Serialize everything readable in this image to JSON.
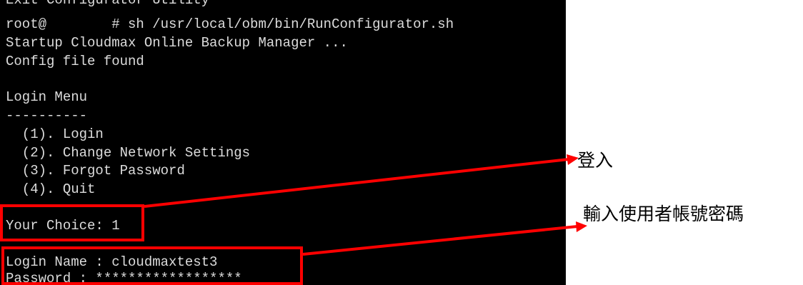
{
  "terminal": {
    "lines": [
      "Exit Configurator Utility",
      "root@        # sh /usr/local/obm/bin/RunConfigurator.sh",
      "Startup Cloudmax Online Backup Manager ...",
      "Config file found",
      "",
      "Login Menu",
      "----------",
      "  (1). Login",
      "  (2). Change Network Settings",
      "  (3). Forgot Password",
      "  (4). Quit",
      "",
      "Your Choice: 1",
      "",
      "Login Name : cloudmaxtest3",
      "Password : ******************"
    ]
  },
  "annotations": {
    "login": "登入",
    "enter_credentials": "輸入使用者帳號密碼"
  },
  "colors": {
    "terminal_bg": "#000000",
    "terminal_text": "#dcdcdc",
    "highlight": "#ff0000"
  }
}
